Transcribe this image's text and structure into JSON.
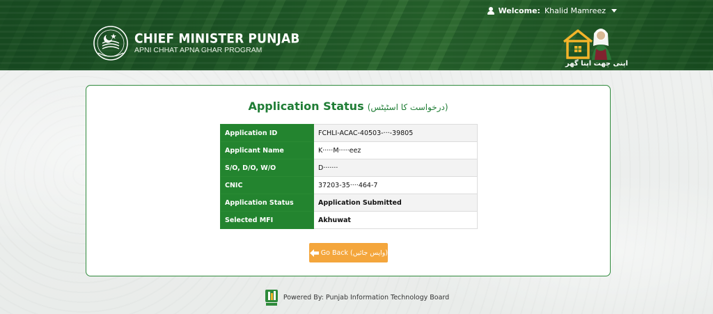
{
  "header": {
    "welcome_label": "Welcome:",
    "user_name": "Khalid Mamreez",
    "brand_title": "CHIEF MINISTER PUNJAB",
    "brand_subtitle": "APNI CHHAT APNA GHAR PROGRAM",
    "logo_urdu": "اپنی چھت اپنا گھر"
  },
  "card": {
    "title_en": "Application Status",
    "title_ur": "(درخواست کا اسٹیٹس)",
    "rows": [
      {
        "label": "Application ID",
        "value": "FCHLI-ACAC-40503-···-39805",
        "bold": false
      },
      {
        "label": "Applicant Name",
        "value": "K·····M·····eez",
        "bold": false
      },
      {
        "label": "S/O, D/O, W/O",
        "value": "D·······",
        "bold": false
      },
      {
        "label": "CNIC",
        "value": "37203-35····464-7",
        "bold": false
      },
      {
        "label": "Application Status",
        "value": "Application Submitted",
        "bold": true
      },
      {
        "label": "Selected MFI",
        "value": "Akhuwat",
        "bold": true
      }
    ],
    "back_button": "Go Back (واپس جائیں)"
  },
  "footer": {
    "text": "Powered By: Punjab Information Technology Board"
  },
  "colors": {
    "primary_green": "#23842f",
    "button_orange": "#f4a63c"
  },
  "icons": [
    "user-icon",
    "caret-down-icon",
    "punjab-emblem-icon",
    "house-logo-icon",
    "arrow-left-icon",
    "pitb-logo-icon"
  ]
}
